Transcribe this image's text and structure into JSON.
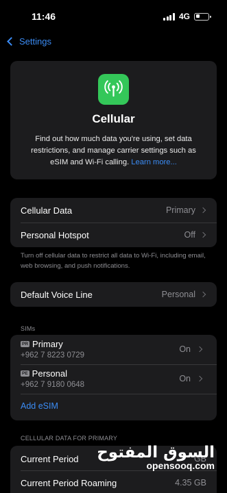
{
  "status_bar": {
    "time": "11:46",
    "network": "4G"
  },
  "nav": {
    "back_label": "Settings"
  },
  "hero": {
    "title": "Cellular",
    "description": "Find out how much data you're using, set data restrictions, and manage carrier settings such as eSIM and Wi-Fi calling.",
    "link": "Learn more..."
  },
  "group1": {
    "rows": [
      {
        "label": "Cellular Data",
        "value": "Primary"
      },
      {
        "label": "Personal Hotspot",
        "value": "Off"
      }
    ],
    "footnote": "Turn off cellular data to restrict all data to Wi-Fi, including email, web browsing, and push notifications."
  },
  "group2": {
    "label": "Default Voice Line",
    "value": "Personal"
  },
  "sims": {
    "header": "SIMs",
    "items": [
      {
        "badge": "PR",
        "name": "Primary",
        "number": "+962 7 8223 0729",
        "status": "On"
      },
      {
        "badge": "PE",
        "name": "Personal",
        "number": "+962 7 9180 0648",
        "status": "On"
      }
    ],
    "add_label": "Add eSIM"
  },
  "data_usage": {
    "header": "CELLULAR DATA FOR PRIMARY",
    "rows": [
      {
        "label": "Current Period",
        "value": "GB"
      },
      {
        "label": "Current Period Roaming",
        "value": "4.35 GB"
      }
    ]
  },
  "watermark": {
    "arabic": "السوق المفتوح",
    "latin": "opensooq.com"
  },
  "colors": {
    "accent": "#3b8cf5",
    "cellular_icon": "#34c759",
    "card": "#1c1c1e",
    "secondary_text": "#8e8e93"
  }
}
